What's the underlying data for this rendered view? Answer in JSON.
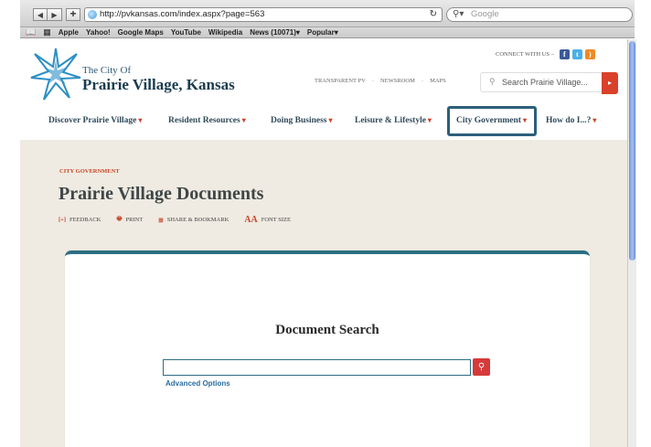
{
  "browser": {
    "back_icon": "back-arrow-icon",
    "forward_icon": "forward-arrow-icon",
    "url": "http://pvkansas.com/index.aspx?page=563",
    "search_placeholder": "Google",
    "bookmarks": [
      "Apple",
      "Yahoo!",
      "Google Maps",
      "YouTube",
      "Wikipedia",
      "News (10071)▾",
      "Popular▾"
    ]
  },
  "site": {
    "logo_line1": "The City Of",
    "logo_line2": "Prairie Village, Kansas",
    "connect_label": "CONNECT WITH US –",
    "top_links": [
      "TRANSPARENT PV",
      "·",
      "NEWSROOM",
      "·",
      "MAPS"
    ],
    "search_placeholder": "Search Prairie Village...",
    "nav": [
      {
        "label": "Discover Prairie Village"
      },
      {
        "label": "Resident Resources"
      },
      {
        "label": "Doing Business"
      },
      {
        "label": "Leisure & Lifestyle"
      },
      {
        "label": "City Government"
      },
      {
        "label": "How do I...?"
      }
    ],
    "active_nav": "City Government",
    "accent_color": "#2c5f7b",
    "red_color": "#d04226"
  },
  "content": {
    "breadcrumb": "CITY GOVERNMENT",
    "title": "Prairie Village Documents",
    "tools": {
      "feedback": "FEEDBACK",
      "print": "PRINT",
      "share": "SHARE & BOOKMARK",
      "font": "FONT SIZE"
    },
    "card_title": "Document Search",
    "search_value": "",
    "advanced_label": "Advanced Options"
  }
}
